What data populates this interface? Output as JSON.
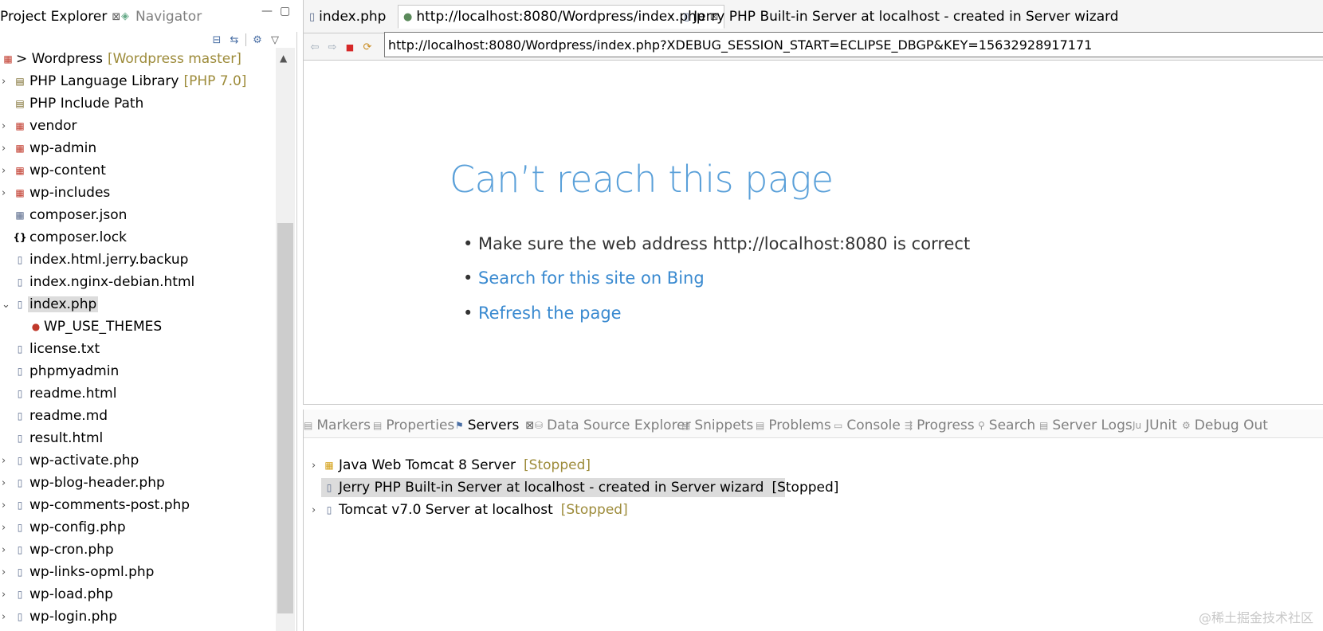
{
  "left_panel": {
    "tabs": [
      {
        "label": "Project Explorer",
        "close": "⊠"
      },
      {
        "label": "Navigator"
      }
    ],
    "tree": [
      {
        "label": "> Wordpress",
        "decor": "[Wordpress master]",
        "icon": "project-icon",
        "arrow": "",
        "indent": 0
      },
      {
        "label": "PHP Language Library",
        "decor": "[PHP 7.0]",
        "icon": "library-icon",
        "arrow": "›",
        "indent": 1
      },
      {
        "label": "PHP Include Path",
        "decor": "",
        "icon": "library-icon",
        "arrow": "",
        "indent": 1
      },
      {
        "label": "vendor",
        "decor": "",
        "icon": "folder-icon",
        "arrow": "›",
        "indent": 1
      },
      {
        "label": "wp-admin",
        "decor": "",
        "icon": "folder-icon",
        "arrow": "›",
        "indent": 1
      },
      {
        "label": "wp-content",
        "decor": "",
        "icon": "folder-icon",
        "arrow": "›",
        "indent": 1
      },
      {
        "label": "wp-includes",
        "decor": "",
        "icon": "folder-icon",
        "arrow": "›",
        "indent": 1
      },
      {
        "label": "composer.json",
        "decor": "",
        "icon": "json-file-icon",
        "arrow": "",
        "indent": 1
      },
      {
        "label": "composer.lock",
        "decor": "",
        "icon": "braces-icon",
        "arrow": "",
        "indent": 1
      },
      {
        "label": "index.html.jerry.backup",
        "decor": "",
        "icon": "file-icon",
        "arrow": "",
        "indent": 1
      },
      {
        "label": "index.nginx-debian.html",
        "decor": "",
        "icon": "file-icon",
        "arrow": "",
        "indent": 1
      },
      {
        "label": "index.php",
        "decor": "",
        "icon": "php-file-icon",
        "arrow": "⌄",
        "indent": 1,
        "selected": true
      },
      {
        "label": "WP_USE_THEMES",
        "decor": "",
        "icon": "constant-icon",
        "arrow": "",
        "indent": 2
      },
      {
        "label": "license.txt",
        "decor": "",
        "icon": "file-icon",
        "arrow": "",
        "indent": 1
      },
      {
        "label": "phpmyadmin",
        "decor": "",
        "icon": "file-icon",
        "arrow": "",
        "indent": 1
      },
      {
        "label": "readme.html",
        "decor": "",
        "icon": "file-icon",
        "arrow": "",
        "indent": 1
      },
      {
        "label": "readme.md",
        "decor": "",
        "icon": "file-icon",
        "arrow": "",
        "indent": 1
      },
      {
        "label": "result.html",
        "decor": "",
        "icon": "file-icon",
        "arrow": "",
        "indent": 1
      },
      {
        "label": "wp-activate.php",
        "decor": "",
        "icon": "php-file-icon",
        "arrow": "›",
        "indent": 1
      },
      {
        "label": "wp-blog-header.php",
        "decor": "",
        "icon": "php-file-icon",
        "arrow": "›",
        "indent": 1
      },
      {
        "label": "wp-comments-post.php",
        "decor": "",
        "icon": "php-file-icon",
        "arrow": "›",
        "indent": 1
      },
      {
        "label": "wp-config.php",
        "decor": "",
        "icon": "php-file-icon",
        "arrow": "›",
        "indent": 1
      },
      {
        "label": "wp-cron.php",
        "decor": "",
        "icon": "php-file-icon",
        "arrow": "›",
        "indent": 1
      },
      {
        "label": "wp-links-opml.php",
        "decor": "",
        "icon": "php-file-icon",
        "arrow": "›",
        "indent": 1
      },
      {
        "label": "wp-load.php",
        "decor": "",
        "icon": "php-file-icon",
        "arrow": "›",
        "indent": 1
      },
      {
        "label": "wp-login.php",
        "decor": "",
        "icon": "php-file-icon",
        "arrow": "›",
        "indent": 1
      }
    ]
  },
  "editor": {
    "tabs": [
      {
        "label": "index.php",
        "icon": "php-file-icon",
        "active": false
      },
      {
        "label": "http://localhost:8080/Wordpress/index.php",
        "icon": "globe-icon",
        "active": true,
        "close": "⊠"
      },
      {
        "label": "Jerry PHP Built-in Server at localhost - created in Server wizard",
        "icon": "server-icon",
        "active": false
      }
    ],
    "url": "http://localhost:8080/Wordpress/index.php?XDEBUG_SESSION_START=ECLIPSE_DBGP&KEY=15632928917171",
    "error": {
      "title": "Can’t reach this page",
      "items": [
        "Make sure the web address http://localhost:8080 is correct",
        "Search for this site on Bing",
        "Refresh the page"
      ]
    }
  },
  "views": {
    "tabs": [
      {
        "label": "Markers",
        "icon": "markers-icon"
      },
      {
        "label": "Properties",
        "icon": "properties-icon"
      },
      {
        "label": "Servers",
        "icon": "servers-icon",
        "active": true,
        "close": "⊠"
      },
      {
        "label": "Data Source Explorer",
        "icon": "data-source-icon"
      },
      {
        "label": "Snippets",
        "icon": "snippets-icon"
      },
      {
        "label": "Problems",
        "icon": "problems-icon"
      },
      {
        "label": "Console",
        "icon": "console-icon"
      },
      {
        "label": "Progress",
        "icon": "progress-icon"
      },
      {
        "label": "Search",
        "icon": "search-icon"
      },
      {
        "label": "Server Logs",
        "icon": "server-logs-icon"
      },
      {
        "label": "JUnit",
        "icon": "junit-icon"
      },
      {
        "label": "Debug Out",
        "icon": "debug-output-icon"
      }
    ],
    "servers": [
      {
        "name": "Java Web Tomcat 8 Server",
        "state": "[Stopped]",
        "arrow": "›",
        "icon": "tomcat-server-icon"
      },
      {
        "name": "Jerry PHP Built-in Server at localhost - created in Server wizard",
        "state": "[Stopped]",
        "arrow": "",
        "icon": "php-server-icon",
        "selected": true
      },
      {
        "name": "Tomcat v7.0 Server at localhost",
        "state": "[Stopped]",
        "arrow": "›",
        "icon": "server-icon"
      }
    ]
  },
  "watermark": "@稀土掘金技术社区"
}
